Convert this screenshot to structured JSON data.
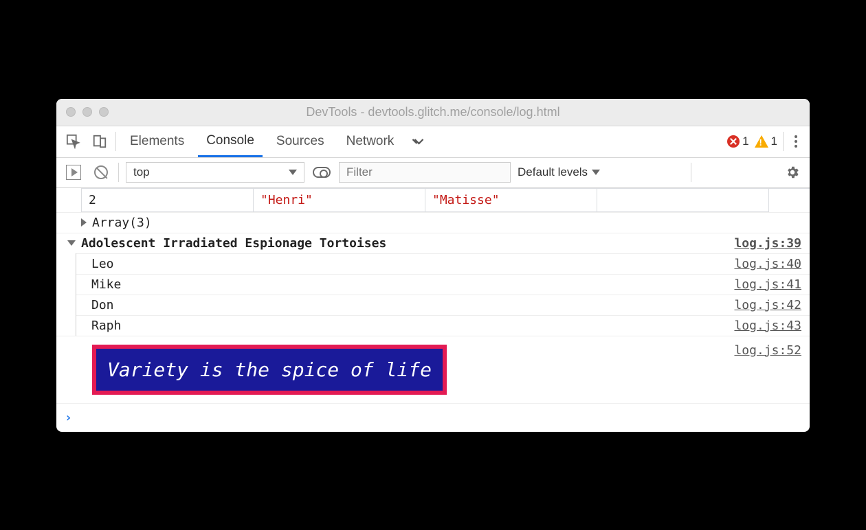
{
  "window": {
    "title": "DevTools - devtools.glitch.me/console/log.html"
  },
  "tabs": {
    "items": [
      "Elements",
      "Console",
      "Sources",
      "Network"
    ],
    "active": "Console",
    "errors": "1",
    "warnings": "1"
  },
  "toolbar": {
    "context": "top",
    "filter_placeholder": "Filter",
    "levels": "Default levels"
  },
  "table": {
    "index": "2",
    "first": "\"Henri\"",
    "last": "\"Matisse\""
  },
  "array_summary": "Array(3)",
  "group": {
    "title": "Adolescent Irradiated Espionage Tortoises",
    "source": "log.js:39",
    "items": [
      {
        "text": "Leo",
        "source": "log.js:40"
      },
      {
        "text": "Mike",
        "source": "log.js:41"
      },
      {
        "text": "Don",
        "source": "log.js:42"
      },
      {
        "text": "Raph",
        "source": "log.js:43"
      }
    ]
  },
  "styled": {
    "text": "Variety is the spice of life",
    "source": "log.js:52"
  }
}
